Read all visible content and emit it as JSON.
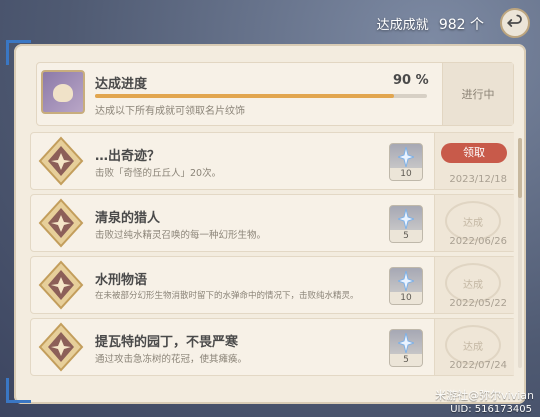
{
  "header": {
    "count_label": "达成成就",
    "count_value": "982 个"
  },
  "progress": {
    "title": "达成进度",
    "percent_text": "90 %",
    "percent": 90,
    "desc": "达成以下所有成就可领取名片纹饰",
    "status": "进行中"
  },
  "achievements": [
    {
      "title": "…出奇迹？",
      "desc": "击败「奇怪的丘丘人」20次。",
      "reward_qty": "10",
      "action": "领取",
      "date": "2023/12/18"
    },
    {
      "title": "清泉的猎人",
      "desc": "击败过纯水精灵召唤的每一种幻形生物。",
      "reward_qty": "5",
      "stamp": "达成",
      "date": "2022/06/26"
    },
    {
      "title": "水刑物语",
      "desc": "在未被部分幻形生物消散时留下的水弹命中的情况下，击败纯水精灵。",
      "reward_qty": "10",
      "stamp": "达成",
      "date": "2022/05/22"
    },
    {
      "title": "提瓦特的园丁，不畏严寒",
      "desc": "通过攻击急冻树的花冠，使其瘫痪。",
      "reward_qty": "5",
      "stamp": "达成",
      "date": "2022/07/24"
    }
  ],
  "footer": {
    "watermark": "米游社@弥尔vivian",
    "uid": "UID: 516173405"
  },
  "colors": {
    "claim_button": "#c85a4a",
    "progress_fill": "#e2a64f",
    "panel_bg": "#f3ecdf"
  }
}
